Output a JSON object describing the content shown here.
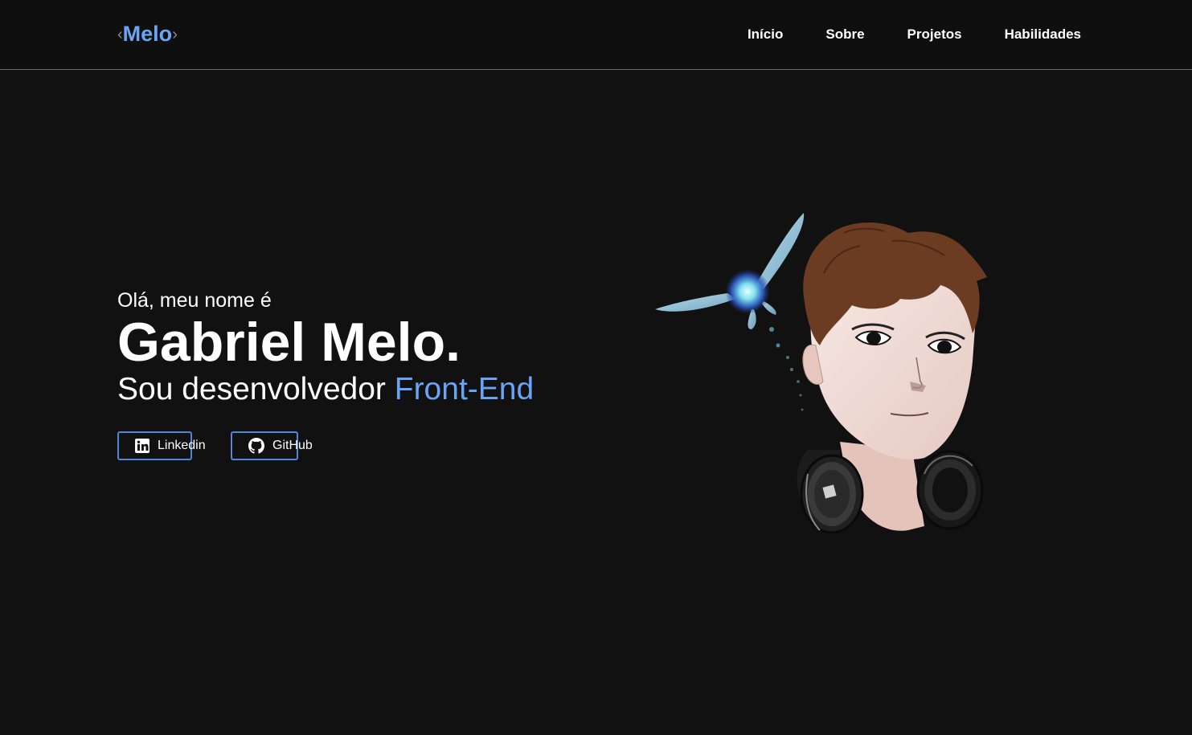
{
  "header": {
    "logo": {
      "bracket_left": "‹",
      "text": "Melo",
      "bracket_right": "›"
    },
    "nav": [
      {
        "label": "Início"
      },
      {
        "label": "Sobre"
      },
      {
        "label": "Projetos"
      },
      {
        "label": "Habilidades"
      }
    ]
  },
  "hero": {
    "greeting": "Olá, meu nome é",
    "name": "Gabriel Melo.",
    "role_prefix": "Sou desenvolvedor ",
    "role_highlight": "Front-End",
    "buttons": [
      {
        "label": "Linkedin",
        "icon": "linkedin-icon"
      },
      {
        "label": "GitHub",
        "icon": "github-icon"
      }
    ]
  },
  "colors": {
    "background": "#111112",
    "accent": "#6aa4f5",
    "button_border": "#4f86d8"
  },
  "illustration": {
    "subject": "avatar-illustration",
    "icon": "fairy-icon"
  }
}
